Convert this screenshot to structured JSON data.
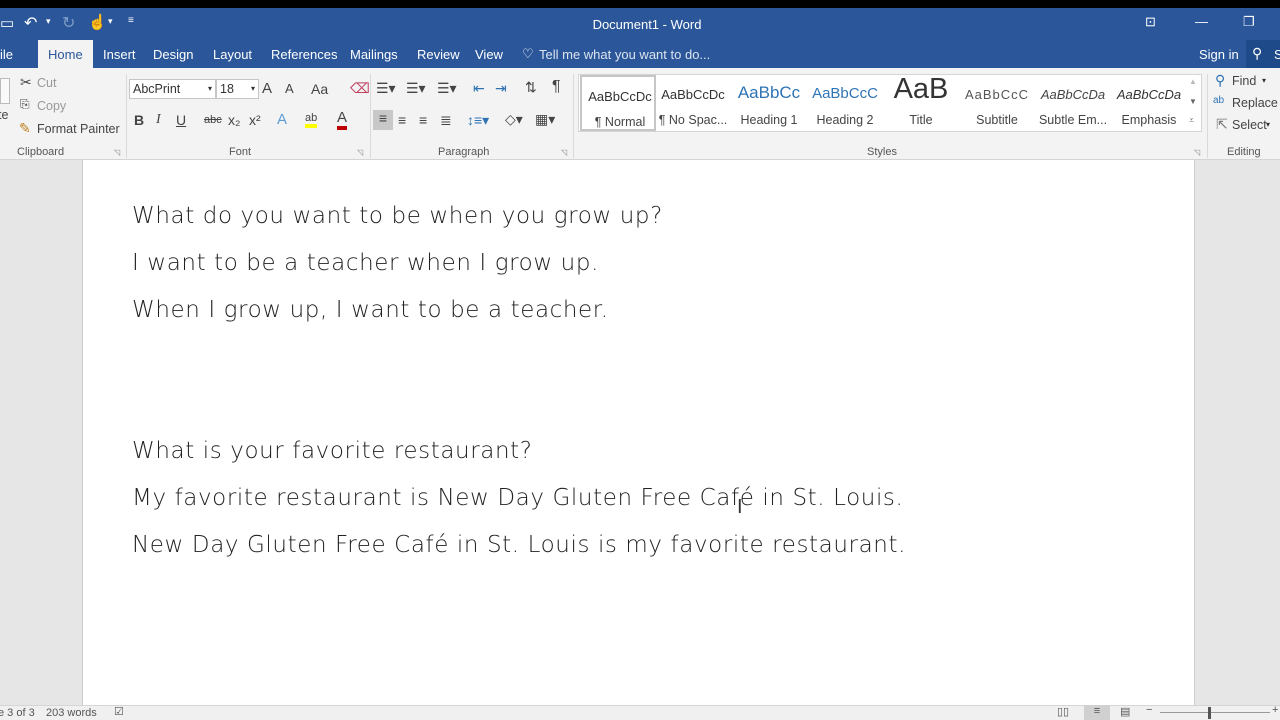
{
  "window": {
    "title": "Document1 - Word"
  },
  "qat": {
    "save": "save-icon",
    "undo": "undo-icon",
    "redo": "redo-icon",
    "touch": "touch-mode-icon",
    "customize": "customize-icon"
  },
  "window_controls": {
    "ribbon_display": "ribbon-display-icon",
    "minimize": "—",
    "restore": "❐"
  },
  "tabs": [
    {
      "label": "ile"
    },
    {
      "label": "Home"
    },
    {
      "label": "Insert"
    },
    {
      "label": "Design"
    },
    {
      "label": "Layout"
    },
    {
      "label": "References"
    },
    {
      "label": "Mailings"
    },
    {
      "label": "Review"
    },
    {
      "label": "View"
    }
  ],
  "tell_me": "Tell me what you want to do...",
  "sign_in": "Sign in",
  "share": "S",
  "clipboard": {
    "paste": "te",
    "cut": "Cut",
    "copy": "Copy",
    "format_painter": "Format Painter",
    "group": "Clipboard"
  },
  "font": {
    "name": "AbcPrint",
    "size": "18",
    "group": "Font",
    "grow": "A",
    "shrink": "A",
    "case": "Aa",
    "bold": "B",
    "italic": "I",
    "underline": "U",
    "strike": "abc",
    "sub": "x₂",
    "sup": "x²",
    "effects": "A",
    "highlight": "ab",
    "color": "A",
    "highlight_color": "#ffff00",
    "font_color": "#c00000"
  },
  "paragraph": {
    "group": "Paragraph",
    "pilcrow": "¶"
  },
  "styles": {
    "group": "Styles",
    "items": [
      {
        "preview": "AaBbCcDc",
        "label": "¶ Normal"
      },
      {
        "preview": "AaBbCcDc",
        "label": "¶ No Spac..."
      },
      {
        "preview": "AaBbCc",
        "label": "Heading 1"
      },
      {
        "preview": "AaBbCcC",
        "label": "Heading 2"
      },
      {
        "preview": "AaB",
        "label": "Title"
      },
      {
        "preview": "AaBbCcC",
        "label": "Subtitle"
      },
      {
        "preview": "AaBbCcDa",
        "label": "Subtle Em..."
      },
      {
        "preview": "AaBbCcDa",
        "label": "Emphasis"
      }
    ]
  },
  "editing": {
    "find": "Find",
    "replace": "Replace",
    "select": "Select",
    "group": "Editing"
  },
  "document": {
    "lines": [
      "What do you want to be when you grow up?",
      "I want to be a teacher when I grow up.",
      "When I grow up, I want to be a teacher.",
      "What is your favorite restaurant?",
      "My favorite restaurant is New Day Gluten Free Café in St. Louis.",
      "New Day Gluten Free Café in St. Louis is my favorite restaurant."
    ]
  },
  "status": {
    "page": "e 3 of 3",
    "words": "203 words"
  },
  "colors": {
    "accent": "#2b579a",
    "heading_blue": "#2e74b5"
  }
}
